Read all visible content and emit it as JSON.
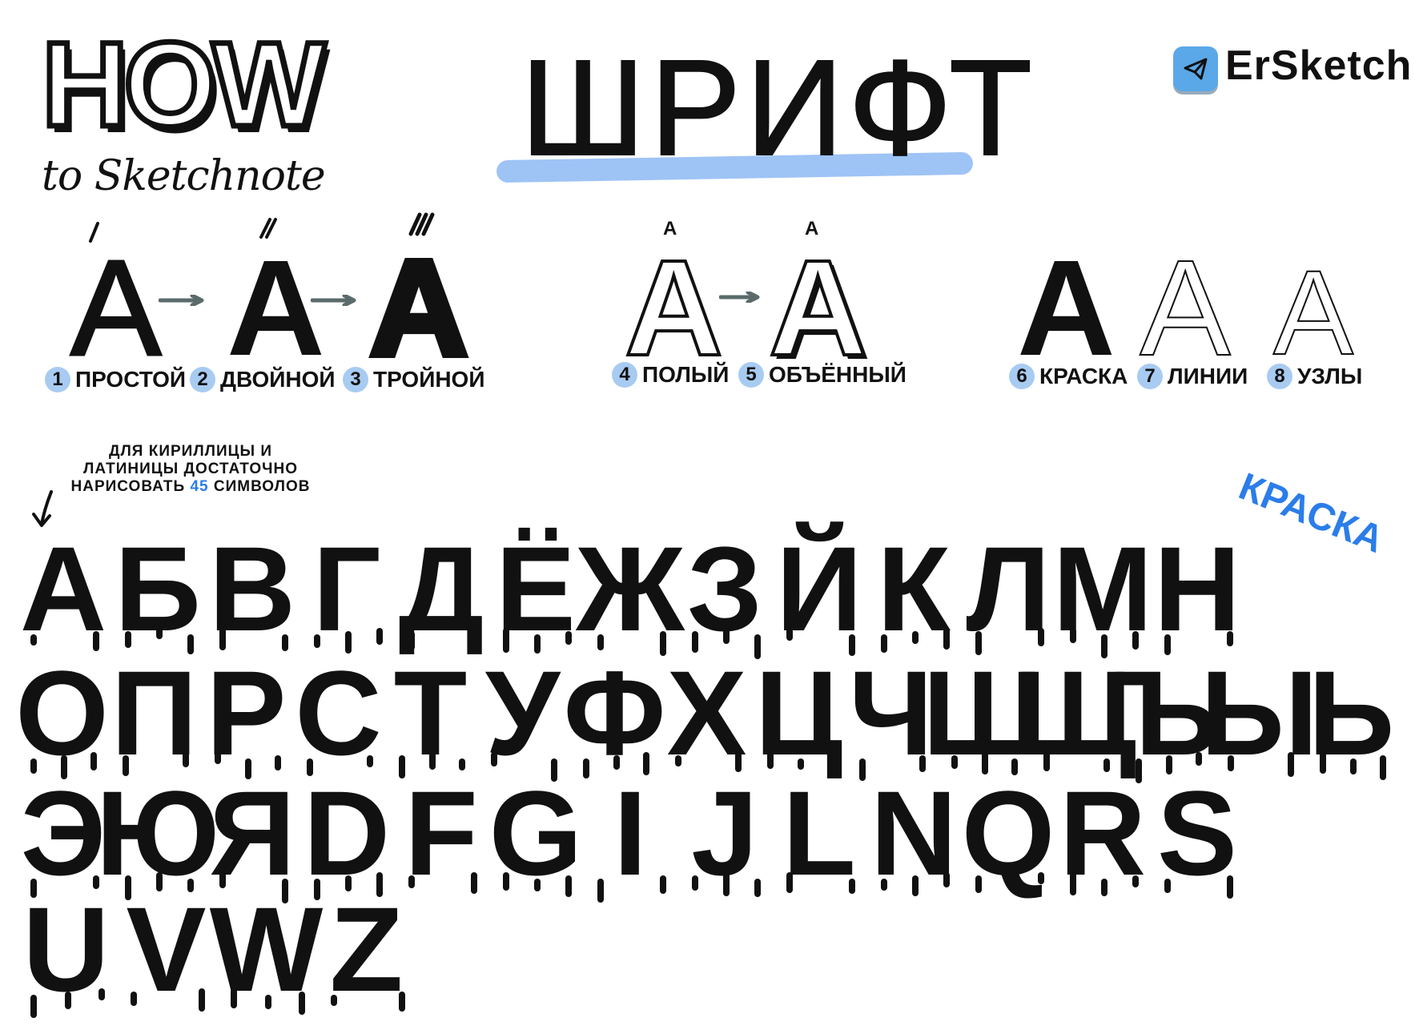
{
  "header": {
    "how_title": "HOW",
    "how_subtitle": "to Sketchnote",
    "main_title": "ШРИФТ",
    "brand": "ErSketch",
    "brand_icon": "telegram-icon",
    "highlight_color": "#9ec3f5"
  },
  "styles_row": {
    "samples": {
      "simple": "А",
      "double": "А",
      "triple": "А",
      "hollow": "А",
      "volume": "А",
      "paint": "А",
      "lines": "А",
      "nodes": "А",
      "hollow_mini": "А",
      "volume_mini": "А"
    },
    "labels": [
      {
        "num": "1",
        "text": "ПРОСТОЙ"
      },
      {
        "num": "2",
        "text": "ДВОЙНОЙ"
      },
      {
        "num": "3",
        "text": "ТРОЙНОЙ"
      },
      {
        "num": "4",
        "text": "ПОЛЫЙ"
      },
      {
        "num": "5",
        "text": "ОБЪЁННЫЙ"
      },
      {
        "num": "6",
        "text": "КРАСКА"
      },
      {
        "num": "7",
        "text": "ЛИНИИ"
      },
      {
        "num": "8",
        "text": "УЗЛЫ"
      }
    ],
    "badge_color": "#a8cbf2"
  },
  "note": {
    "line1": "ДЛЯ КИРИЛЛИЦЫ И",
    "line2": "ЛАТИНИЦЫ ДОСТАТОЧНО",
    "line3_a": "НАРИСОВАТЬ",
    "line3_num": "45",
    "line3_b": "СИМВОЛОВ",
    "accent_color": "#2b7de9"
  },
  "alphabet_label": "КРАСКА",
  "alphabet": {
    "row1": [
      "А",
      "Б",
      "В",
      "Г",
      "Д",
      "Ё",
      "Ж",
      "З",
      "Й",
      "К",
      "Л",
      "М",
      "Н"
    ],
    "row2": [
      "О",
      "П",
      "Р",
      "С",
      "Т",
      "У",
      "Ф",
      "Х",
      "Ц",
      "Ч",
      "Ш",
      "Щ",
      "Ъ",
      "Ы",
      "Ь"
    ],
    "row3": [
      "Э",
      "Ю",
      "Я",
      "D",
      "F",
      "G",
      "I",
      "J",
      "L",
      "N",
      "Q",
      "R",
      "S"
    ],
    "row4": [
      "U",
      "V",
      "W",
      "Z"
    ]
  }
}
